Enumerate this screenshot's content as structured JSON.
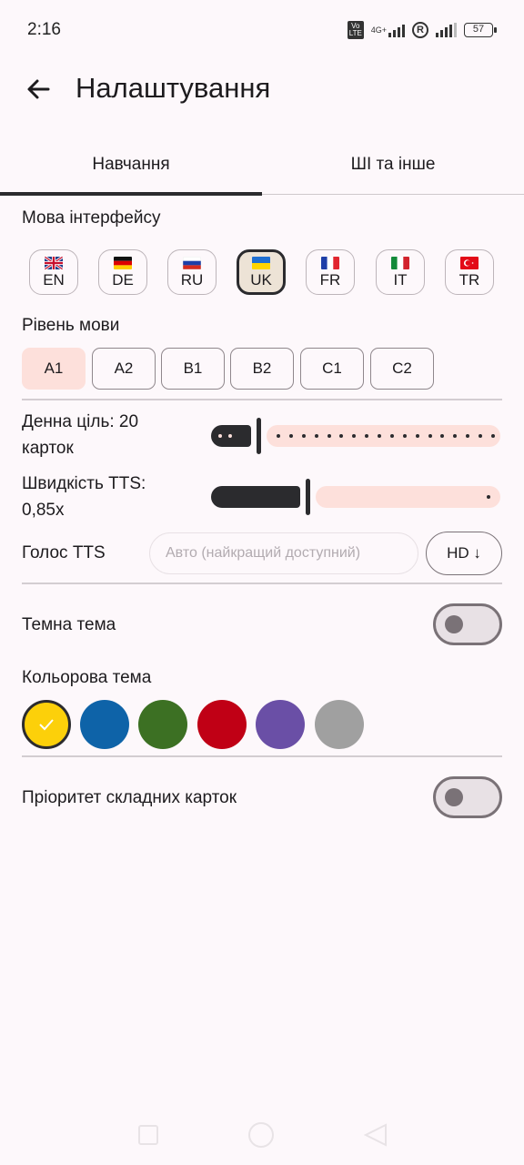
{
  "status_bar": {
    "time": "2:16",
    "volte": "Vo LTE",
    "network": "4G+",
    "roaming": "R",
    "battery": "57"
  },
  "header": {
    "back_icon": "arrow-left-icon",
    "title": "Налаштування"
  },
  "tabs": [
    {
      "label": "Навчання",
      "selected": true
    },
    {
      "label": "ШІ та інше",
      "selected": false
    }
  ],
  "interface_language": {
    "label": "Мова інтерфейсу",
    "options": [
      {
        "code": "EN",
        "flag": "flag-gb-icon",
        "selected": false
      },
      {
        "code": "DE",
        "flag": "flag-de-icon",
        "selected": false
      },
      {
        "code": "RU",
        "flag": "flag-ru-icon",
        "selected": false
      },
      {
        "code": "UK",
        "flag": "flag-ua-icon",
        "selected": true
      },
      {
        "code": "FR",
        "flag": "flag-fr-icon",
        "selected": false
      },
      {
        "code": "IT",
        "flag": "flag-it-icon",
        "selected": false
      },
      {
        "code": "TR",
        "flag": "flag-tr-icon",
        "selected": false
      }
    ]
  },
  "language_level": {
    "label": "Рівень мови",
    "options": [
      "A1",
      "A2",
      "B1",
      "B2",
      "C1",
      "C2"
    ],
    "selected": "A1"
  },
  "daily_goal": {
    "label_line1": "Денна ціль: 20",
    "label_line2": "карток",
    "value": 20,
    "steps_total": 20,
    "steps_filled": 2
  },
  "tts_speed": {
    "label_line1": "Швидкість TTS:",
    "label_line2": "0,85x",
    "value": 0.85,
    "fraction": 0.33
  },
  "tts_voice": {
    "label": "Голос TTS",
    "placeholder": "Авто (найкращий доступний)",
    "hd_button": "HD ↓"
  },
  "dark_theme": {
    "label": "Темна тема",
    "enabled": false
  },
  "color_theme": {
    "label": "Кольорова тема",
    "colors": [
      "#fcd00a",
      "#0e63a8",
      "#3c7023",
      "#c00015",
      "#6a4fa6",
      "#a0a0a0"
    ],
    "selected_index": 0
  },
  "hard_cards_priority": {
    "label": "Пріоритет складних карток",
    "enabled": false
  },
  "accent_colors": {
    "selected_chip": "#ede3d6",
    "level_selected": "#fde0db",
    "slider_track": "#fde0db",
    "dark": "#2b2b2e"
  }
}
